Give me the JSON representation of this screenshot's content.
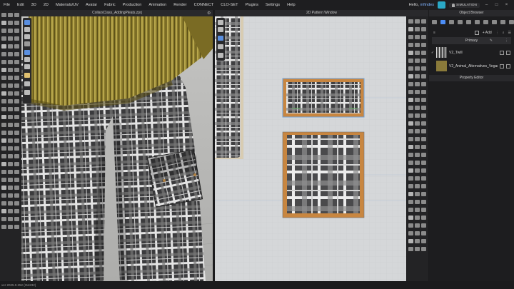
{
  "app": {
    "greeting_prefix": "Hello, ",
    "user": "mfindes",
    "mode": "SIMULATION"
  },
  "menu": [
    "File",
    "Edit",
    "3D",
    "2D",
    "Materials/UV",
    "Avatar",
    "Fabric",
    "Production",
    "Animation",
    "Render",
    "CONNECT",
    "CLO-SET",
    "Plugins",
    "Settings",
    "Help"
  ],
  "viewport3d": {
    "title": "CollarsClass_AddingPleats.zprj"
  },
  "viewport2d": {
    "title": "2D Pattern Window"
  },
  "object_browser": {
    "title": "Object Browser",
    "add_label": "+ Add",
    "group": "Primary",
    "items": [
      {
        "label": "V2_Twill",
        "checked": "✓",
        "swatch_color": "#6e6e6e"
      },
      {
        "label": "V2_Animal_Alternatives_Vegan",
        "checked": "",
        "swatch_color": "#8a7a3a"
      }
    ]
  },
  "property_editor": {
    "title": "Property Editor"
  },
  "status": {
    "version": "ver 2025.0.252 (r54232)"
  },
  "colors": {
    "plaid_dark": "#3a3a3c",
    "plaid_light": "#e6e6e6",
    "plaid_orange": "#c88640",
    "olive_fabric": "#8c7a2e",
    "accent": "#4c8ef7"
  }
}
